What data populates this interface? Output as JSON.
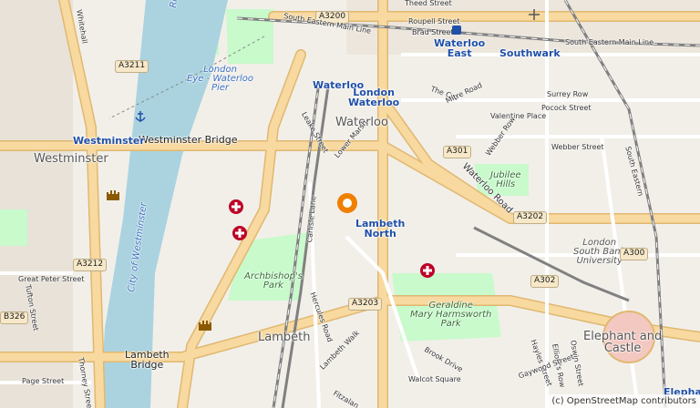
{
  "map": {
    "area_labels": {
      "waterloo": "Waterloo",
      "westminster": "Westminster",
      "lambeth": "Lambeth",
      "elephant_and_castle": "Elephant and\nCastle"
    },
    "bridge_labels": {
      "westminster_bridge": "Westminster Bridge",
      "lambeth_bridge": "Lambeth\nBridge"
    },
    "stations": {
      "waterloo_east": "Waterloo\nEast",
      "southwark": "Southwark",
      "waterloo_underground": "Waterloo",
      "london_waterloo": "London\nWaterloo",
      "westminster": "Westminster",
      "lambeth_north": "Lambeth\nNorth",
      "elephant_partial": "Elephan"
    },
    "water_labels": {
      "river_thames": "River Tha",
      "city_of_westminster": "City of Westminster",
      "london_eye_pier": "London\nEye - Waterloo\nPier"
    },
    "park_labels": {
      "archbishops_park": "Archbishop's\nPark",
      "geraldine_park": "Geraldine\nMary Harmsworth\nPark",
      "jubilee_hills": "Jubilee\nHills"
    },
    "university": "London\nSouth Bank\nUniversity",
    "road_shields": [
      "A3200",
      "A3211",
      "A301",
      "A3202",
      "A3212",
      "A3203",
      "A302",
      "A300",
      "B326"
    ],
    "railway_labels": {
      "south_eastern_main_line_top": "South Eastern Main Line",
      "south_eastern_main_line_right": "South Eastern Main Line",
      "south_eastern": "South Eastern"
    },
    "streets": {
      "whitehall": "Whitehall",
      "waterloo_road": "Waterloo Road",
      "lower_marsh": "Lower Marsh",
      "the_cut": "The Cut",
      "mitre_road": "Mitre Road",
      "valentine_place": "Valentine Place",
      "webber_street": "Webber Street",
      "webber_row": "Webber Row",
      "surrey_row": "Surrey Row",
      "pocock_street": "Pocock Street",
      "thead_street": "Theed Street",
      "roupell_street": "Roupell Street",
      "brad_street": "Brad Street",
      "great_peter_street": "Great Peter Street",
      "tufton_street": "Tufton Street",
      "page_street": "Page Street",
      "thorney_street": "Thorney Street",
      "carlisle_lane": "Carlisle Lane",
      "hercules_road": "Hercules Road",
      "lambeth_walk": "Lambeth Walk",
      "brook_drive": "Brook Drive",
      "walcot_square": "Walcot Square",
      "fitzalan": "Fitzalan",
      "hayles_street": "Hayles Street",
      "elliotts_row": "Elliott's Row",
      "oswin_street": "Oswin Street",
      "gaywood_street": "Gaywood Street",
      "leake_street": "Leake Street"
    },
    "attribution": "(c) OpenStreetMap contributors"
  },
  "colors": {
    "land": "#f2efe9",
    "water": "#aad3df",
    "park": "#c8facc",
    "road": "#f8d9a0",
    "road_edge": "#e0b870",
    "minor_road": "#ffffff",
    "rail": "#808080",
    "hospital": "#bd0026",
    "station": "#2050a8",
    "marker": "#f08000"
  },
  "icons": [
    "hospital-icon",
    "castle-icon",
    "station-icon",
    "marker-icon",
    "pier-anchor-icon"
  ]
}
